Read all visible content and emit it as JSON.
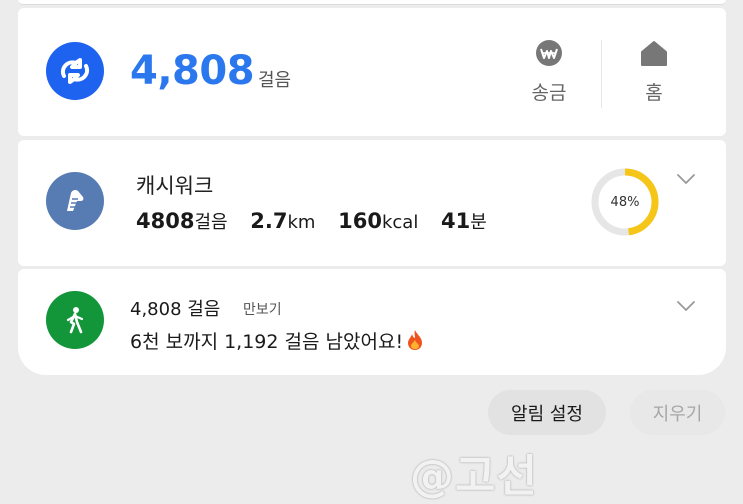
{
  "summary": {
    "steps": "4,808",
    "steps_unit": "걸음",
    "actions": [
      {
        "label": "송금",
        "icon": "won-coin-icon"
      },
      {
        "label": "홈",
        "icon": "home-icon"
      }
    ],
    "colors": {
      "logo_bg": "#1e63f0",
      "steps_text": "#2b78ee"
    }
  },
  "cashwalk": {
    "title": "캐시워크",
    "icon": "shoe-icon",
    "stats": [
      {
        "value": "4808",
        "unit": "걸음"
      },
      {
        "value": "2.7",
        "unit": "km"
      },
      {
        "value": "160",
        "unit": "kcal"
      },
      {
        "value": "41",
        "unit": "분"
      }
    ],
    "progress_label": "48%",
    "progress_fraction": 0.48,
    "colors": {
      "icon_bg": "#577bb3",
      "ring": "#f5c518",
      "ring_track": "#e6e6e6"
    }
  },
  "pedometer": {
    "title": "4,808 걸음",
    "app_name": "만보기",
    "message": "6천 보까지 1,192 걸음 남았어요!",
    "icon": "walking-person-icon",
    "emoji": "fire-icon",
    "colors": {
      "icon_bg": "#13963a"
    }
  },
  "buttons": {
    "settings": "알림 설정",
    "clear": "지우기"
  },
  "watermark": "@고선"
}
